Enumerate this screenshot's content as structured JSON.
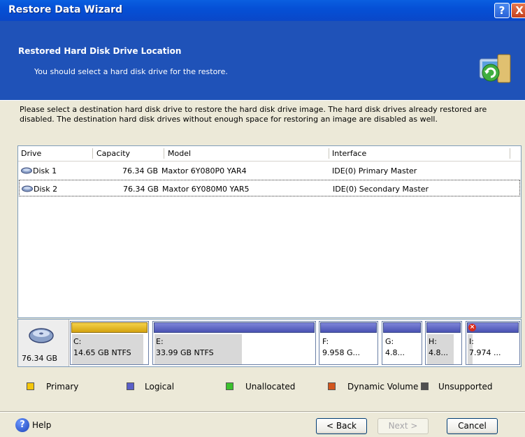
{
  "window": {
    "title": "Restore Data Wizard",
    "help_btn": "?",
    "close_btn": "X"
  },
  "header": {
    "title": "Restored Hard Disk Drive Location",
    "subtitle": "You should select a hard disk drive for the restore."
  },
  "description": "Please select a destination hard disk drive to restore the hard disk drive image. The hard disk drives already restored are disabled. The destination hard disk drives without enough space for restoring an image are disabled as well.",
  "table": {
    "columns": [
      "Drive",
      "Capacity",
      "Model",
      "Interface"
    ],
    "rows": [
      {
        "drive": "Disk 1",
        "capacity": "76.34 GB",
        "model": "Maxtor 6Y080P0 YAR4",
        "interface": "IDE(0) Primary Master"
      },
      {
        "drive": "Disk 2",
        "capacity": "76.34 GB",
        "model": "Maxtor 6Y080M0 YAR5",
        "interface": "IDE(0) Secondary Master"
      }
    ]
  },
  "disk_map": {
    "capacity": "76.34 GB",
    "partitions": [
      {
        "line1": "C:",
        "line2": "14.65 GB  NTFS",
        "type": "primary",
        "used_fraction": 0.95
      },
      {
        "line1": "E:",
        "line2": "33.99 GB  NTFS",
        "type": "logical",
        "used_fraction": 0.55
      },
      {
        "line1": "F:",
        "line2": "9.958 G...",
        "type": "logical",
        "used_fraction": 0.0
      },
      {
        "line1": "G:",
        "line2": "4.8...",
        "type": "logical",
        "used_fraction": 0.0
      },
      {
        "line1": "H:",
        "line2": "4.8...",
        "type": "logical",
        "used_fraction": 0.8
      },
      {
        "line1": "I:",
        "line2": "7.974 ...",
        "type": "logical",
        "used_fraction": 0.1,
        "error": true
      }
    ]
  },
  "legend": [
    {
      "label": "Primary",
      "color": "#F4C60A"
    },
    {
      "label": "Logical",
      "color": "#5A5FC8"
    },
    {
      "label": "Unallocated",
      "color": "#3CC12D"
    },
    {
      "label": "Dynamic Volume",
      "color": "#D2561D"
    },
    {
      "label": "Unsupported",
      "color": "#505050"
    }
  ],
  "buttons": {
    "help": "Help",
    "back": "< Back",
    "next": "Next >",
    "cancel": "Cancel"
  },
  "colors": {
    "header_bg": "#1F52B8",
    "titlebar": "#0550D6",
    "dialog_bg": "#ECE9D8"
  }
}
